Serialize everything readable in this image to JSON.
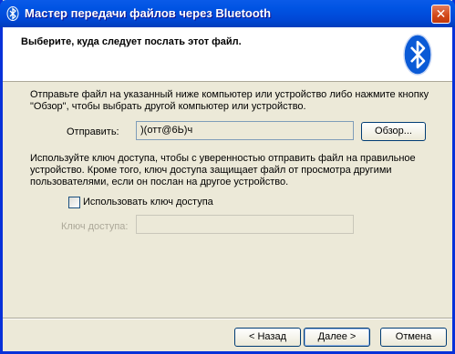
{
  "window": {
    "title": "Мастер передачи файлов через Bluetooth",
    "close_label": "✕"
  },
  "header": {
    "title": "Выберите, куда следует послать этот файл."
  },
  "content": {
    "instruction": "Отправьте файл на указанный ниже компьютер или устройство либо нажмите кнопку \"Обзор\", чтобы выбрать другой компьютер или устройство.",
    "send_label": "Отправить:",
    "send_value": ")(отт@6Ь)ч",
    "browse_label": "Обзор...",
    "passkey_info": "Используйте ключ доступа, чтобы с уверенностью отправить файл на правильное устройство. Кроме того, ключ доступа защищает файл от просмотра другими пользователями, если он послан на другое устройство.",
    "use_passkey_label": "Использовать ключ доступа",
    "use_passkey_checked": false,
    "passkey_label": "Ключ доступа:",
    "passkey_value": ""
  },
  "footer": {
    "back_label": "< Назад",
    "next_label": "Далее >",
    "cancel_label": "Отмена"
  },
  "colors": {
    "titlebar": "#0054e3",
    "bluetooth": "#0a5ad6",
    "dialog_bg": "#ece9d8"
  }
}
